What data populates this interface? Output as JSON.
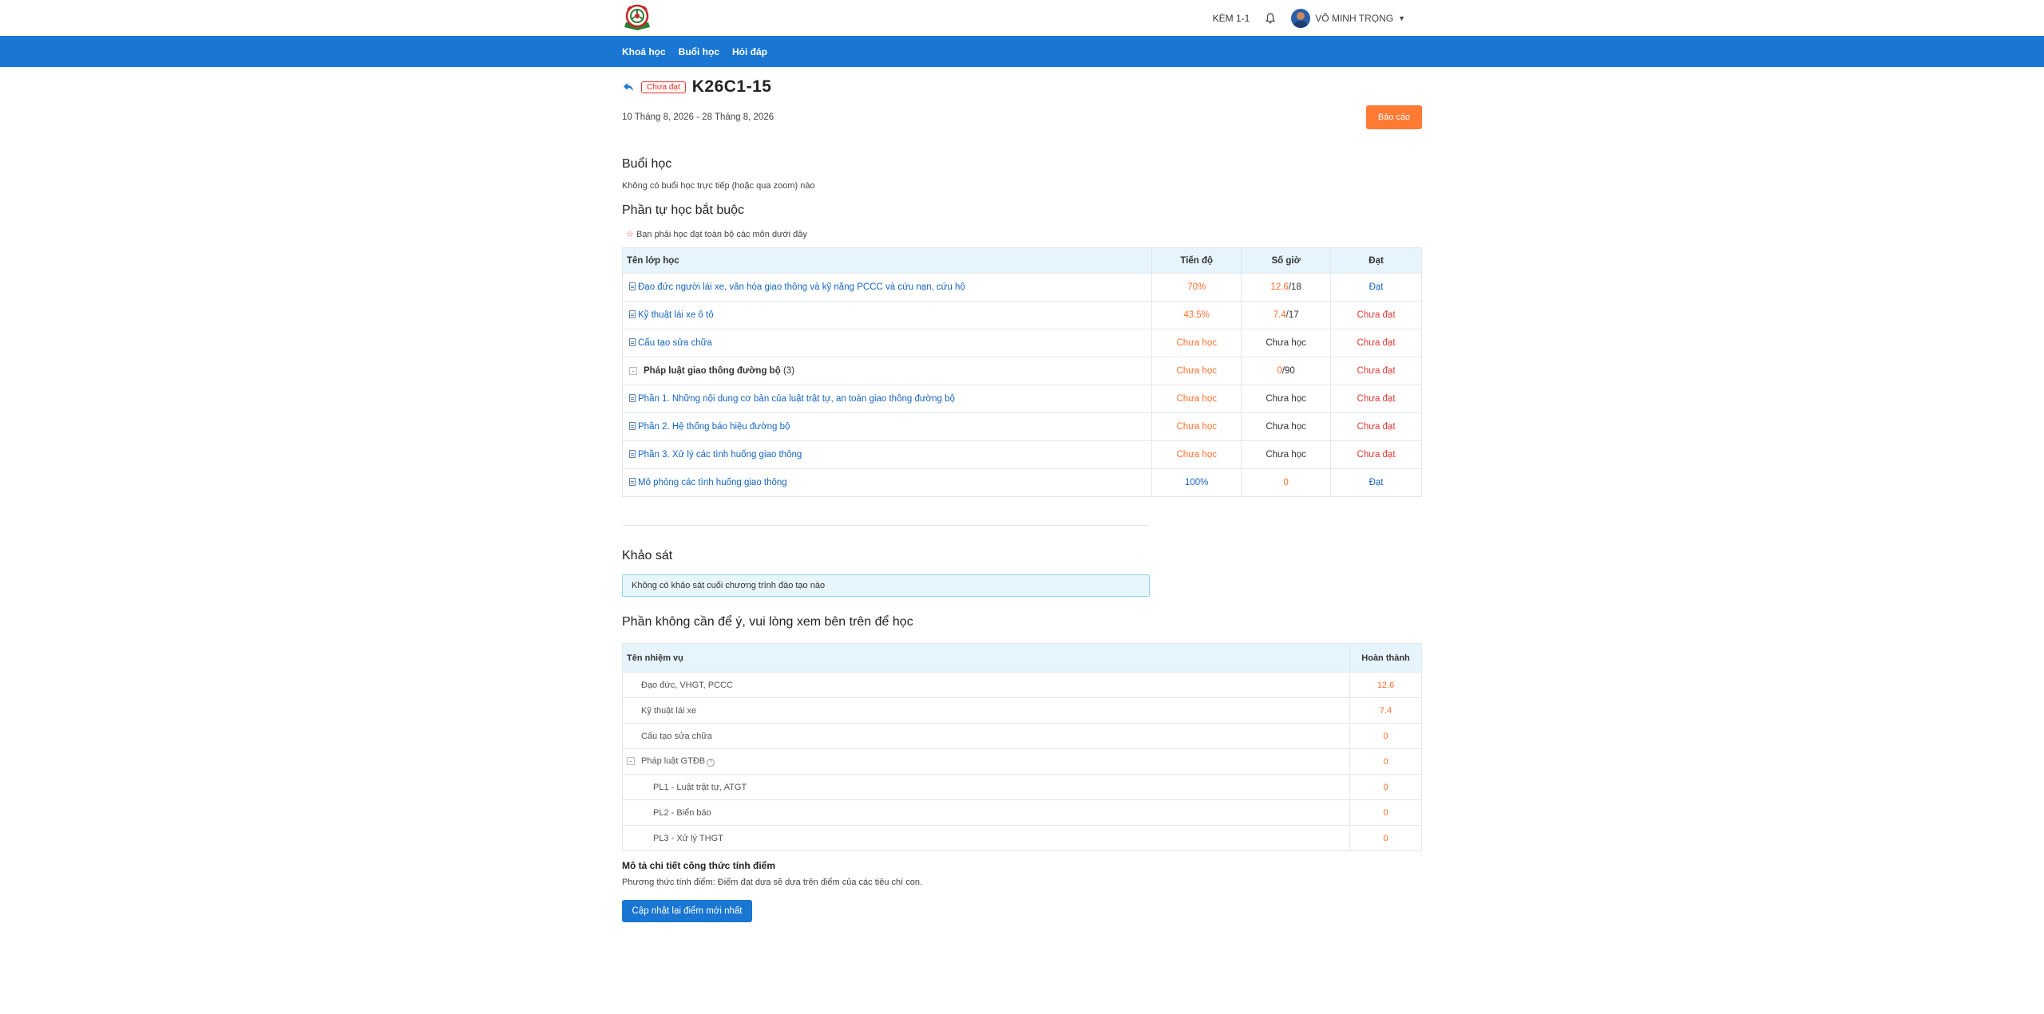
{
  "header": {
    "kem_label": "KÈM 1-1",
    "user_name": "VÕ MINH TRỌNG",
    "logo_icon": "academy-logo",
    "bell_icon": "bell-icon"
  },
  "nav": {
    "items": [
      {
        "label": "Khoá học"
      },
      {
        "label": "Buổi học"
      },
      {
        "label": "Hỏi đáp"
      }
    ]
  },
  "page": {
    "status_badge": "Chưa đạt",
    "title": "K26C1-15",
    "date_range": "10 Tháng 8, 2026 - 28 Tháng 8, 2026",
    "report_button": "Báo cáo"
  },
  "sessions": {
    "heading": "Buổi học",
    "empty_text": "Không có buổi học trực tiếp (hoặc qua zoom) nào"
  },
  "required": {
    "heading": "Phần tự học bắt buộc",
    "note": "Bạn phải học đạt toàn bộ các môn dưới đây",
    "columns": [
      "Tên lớp học",
      "Tiến độ",
      "Số giờ",
      "Đạt"
    ],
    "rows": [
      {
        "name": "Đạo đức người lái xe, văn hóa giao thông và kỹ năng PCCC và cứu nạn, cứu hộ",
        "progress": "70%",
        "hours_done": "12.6",
        "hours_total": "/18",
        "status": "Đạt"
      },
      {
        "name": "Kỹ thuật lái xe ô tô",
        "progress": "43.5%",
        "hours_done": "7.4",
        "hours_total": "/17",
        "status": "Chưa đạt"
      },
      {
        "name": "Cấu tạo sửa chữa",
        "progress": "Chưa học",
        "hours": "Chưa học",
        "status": "Chưa đạt"
      },
      {
        "name": "Pháp luật giao thông đường bộ",
        "count": "(3)",
        "progress": "Chưa học",
        "hours_done": "0",
        "hours_total": "/90",
        "status": "Chưa đạt"
      },
      {
        "name": "Phần 1. Những nội dung cơ bản của luật trật tự, an toàn giao thông đường bộ",
        "progress": "Chưa học",
        "hours": "Chưa học",
        "status": "Chưa đạt"
      },
      {
        "name": "Phần 2. Hệ thống báo hiệu đường bộ",
        "progress": "Chưa học",
        "hours": "Chưa học",
        "status": "Chưa đạt"
      },
      {
        "name": "Phần 3. Xử lý các tình huống giao thông",
        "progress": "Chưa học",
        "hours": "Chưa học",
        "status": "Chưa đạt"
      },
      {
        "name": "Mô phỏng các tình huống giao thông",
        "progress": "100%",
        "hours": "0",
        "status": "Đạt"
      }
    ]
  },
  "survey": {
    "heading": "Khảo sát",
    "empty_text": "Không có khảo sát cuối chương trình đào tạo nào"
  },
  "optional": {
    "heading": "Phần không cần để ý, vui lòng xem bên trên để học",
    "columns": [
      "Tên nhiệm vụ",
      "Hoàn thành"
    ],
    "rows": [
      {
        "name": "Đạo đức, VHGT, PCCC",
        "value": "12.6"
      },
      {
        "name": "Kỹ thuật lái xe",
        "value": "7.4"
      },
      {
        "name": "Cấu tạo sửa chữa",
        "value": "0"
      },
      {
        "name": "Pháp luật GTĐB",
        "value": "0"
      },
      {
        "name": "PL1 - Luật trật tự, ATGT",
        "value": "0"
      },
      {
        "name": "PL2 - Biển báo",
        "value": "0"
      },
      {
        "name": "PL3 - Xử lý THGT",
        "value": "0"
      }
    ]
  },
  "formula": {
    "title": "Mô tả chi tiết công thức tính điểm",
    "desc": "Phương thức tính điểm: Điểm đạt dựa sẽ dựa trên điểm của các tiêu chí con.",
    "update_button": "Cập nhật lại điểm mới nhất"
  },
  "colors": {
    "nav_blue": "#1976d2",
    "report_orange": "#ff7a33",
    "fail_red": "#e53935",
    "progress_orange": "#ff6f2c"
  }
}
